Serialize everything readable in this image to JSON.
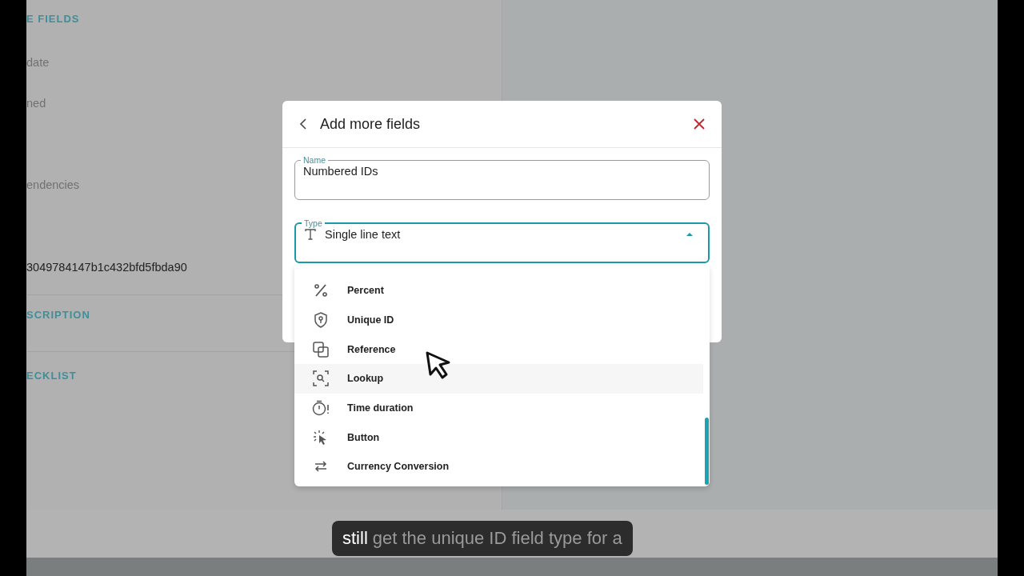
{
  "background_panel": {
    "section_heading": "E FIELDS",
    "fields": [
      "date",
      "ned",
      "endencies"
    ],
    "id_value": "3049784147b1c432bfd5fbda90",
    "sections": [
      "SCRIPTION",
      "ECKLIST"
    ]
  },
  "dialog": {
    "title": "Add more fields",
    "name_field": {
      "label": "Name",
      "value": "Numbered IDs"
    },
    "type_field": {
      "label": "Type",
      "value": "Single line text",
      "expanded": true
    },
    "type_options": [
      {
        "kind": "percent",
        "label": "Percent",
        "selected": false
      },
      {
        "kind": "unique-id",
        "label": "Unique ID",
        "selected": false
      },
      {
        "kind": "reference",
        "label": "Reference",
        "selected": false
      },
      {
        "kind": "lookup",
        "label": "Lookup",
        "selected": true
      },
      {
        "kind": "duration",
        "label": "Time duration",
        "selected": false
      },
      {
        "kind": "button",
        "label": "Button",
        "selected": false
      },
      {
        "kind": "currency",
        "label": "Currency Conversion",
        "selected": false
      }
    ]
  },
  "caption": {
    "spoken": "still",
    "upcoming": "get the unique ID field type for a"
  }
}
